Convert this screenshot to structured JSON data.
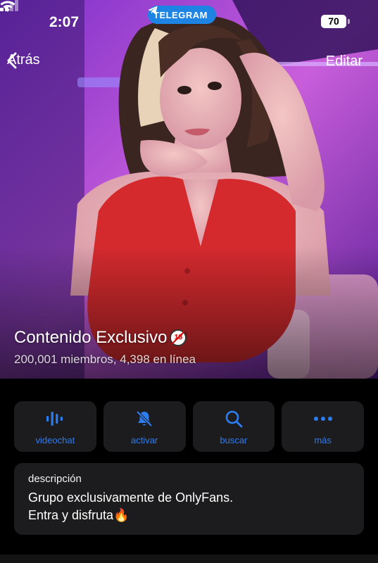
{
  "status_bar": {
    "time": "2:07",
    "app_pill": "TELEGRAM",
    "battery": "70"
  },
  "nav": {
    "back_label": "Atrás",
    "edit_label": "Editar"
  },
  "channel": {
    "title": "Contenido Exclusivo",
    "subtitle": "200,001 miembros, 4,398 en línea"
  },
  "actions": [
    {
      "label": "videochat",
      "icon": "voice-chat-icon"
    },
    {
      "label": "activar",
      "icon": "bell-muted-icon"
    },
    {
      "label": "buscar",
      "icon": "search-icon"
    },
    {
      "label": "más",
      "icon": "more-dots-icon"
    }
  ],
  "description": {
    "label": "descripción",
    "text": "Grupo exclusivamente de OnlyFans.\nEntra y disfruta🔥"
  },
  "colors": {
    "accent": "#2d7cf0",
    "pill": "#1e84e4",
    "card": "#1c1c1e",
    "background": "#000000"
  }
}
